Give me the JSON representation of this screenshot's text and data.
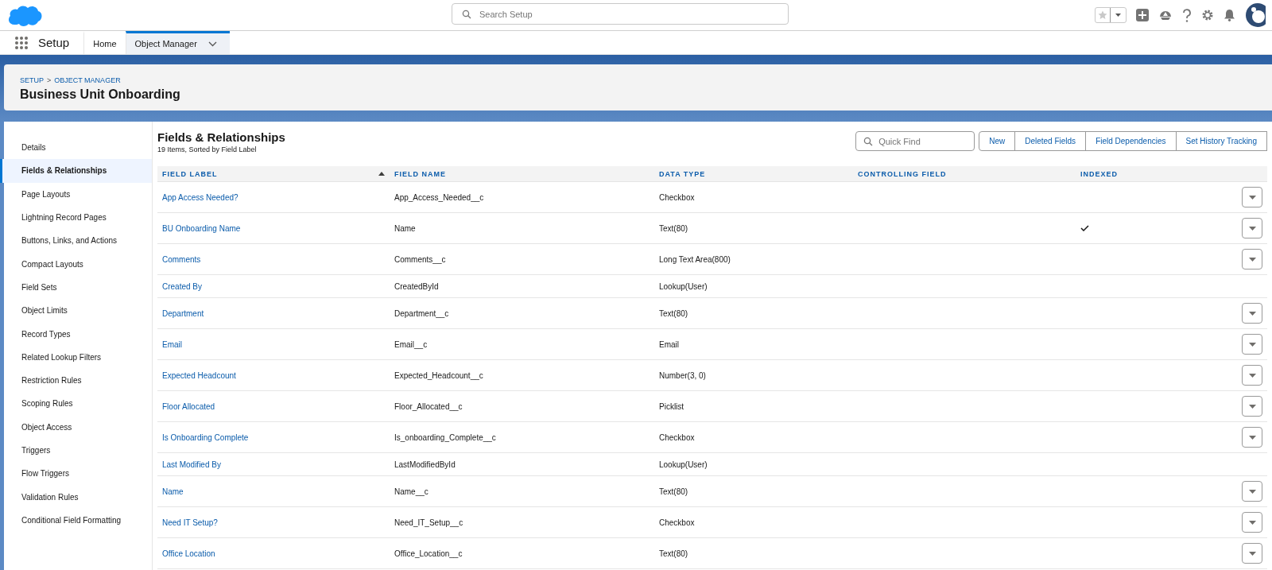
{
  "header": {
    "search": {
      "placeholder": "Search Setup"
    }
  },
  "nav": {
    "app_name": "Setup",
    "tabs": [
      {
        "label": "Home",
        "selected": false,
        "has_menu": false
      },
      {
        "label": "Object Manager",
        "selected": true,
        "has_menu": true
      }
    ]
  },
  "page_header": {
    "breadcrumbs": [
      "SETUP",
      "OBJECT MANAGER"
    ],
    "separator": ">",
    "title": "Business Unit Onboarding"
  },
  "sidebar": {
    "items": [
      {
        "label": "Details",
        "selected": false
      },
      {
        "label": "Fields & Relationships",
        "selected": true
      },
      {
        "label": "Page Layouts",
        "selected": false
      },
      {
        "label": "Lightning Record Pages",
        "selected": false
      },
      {
        "label": "Buttons, Links, and Actions",
        "selected": false
      },
      {
        "label": "Compact Layouts",
        "selected": false
      },
      {
        "label": "Field Sets",
        "selected": false
      },
      {
        "label": "Object Limits",
        "selected": false
      },
      {
        "label": "Record Types",
        "selected": false
      },
      {
        "label": "Related Lookup Filters",
        "selected": false
      },
      {
        "label": "Restriction Rules",
        "selected": false
      },
      {
        "label": "Scoping Rules",
        "selected": false
      },
      {
        "label": "Object Access",
        "selected": false
      },
      {
        "label": "Triggers",
        "selected": false
      },
      {
        "label": "Flow Triggers",
        "selected": false
      },
      {
        "label": "Validation Rules",
        "selected": false
      },
      {
        "label": "Conditional Field Formatting",
        "selected": false
      }
    ]
  },
  "section": {
    "title": "Fields & Relationships",
    "subtitle": "19 Items, Sorted by Field Label",
    "quick_find": {
      "placeholder": "Quick Find"
    },
    "buttons": [
      "New",
      "Deleted Fields",
      "Field Dependencies",
      "Set History Tracking"
    ]
  },
  "table": {
    "columns": [
      {
        "label": "FIELD LABEL",
        "sorted": true
      },
      {
        "label": "FIELD NAME",
        "sorted": false
      },
      {
        "label": "DATA TYPE",
        "sorted": false
      },
      {
        "label": "CONTROLLING FIELD",
        "sorted": false
      },
      {
        "label": "INDEXED",
        "sorted": false
      }
    ],
    "rows": [
      {
        "field_label": "App Access Needed?",
        "field_name": "App_Access_Needed__c",
        "data_type": "Checkbox",
        "indexed": false,
        "has_actions": true
      },
      {
        "field_label": "BU Onboarding Name",
        "field_name": "Name",
        "data_type": "Text(80)",
        "indexed": true,
        "has_actions": true
      },
      {
        "field_label": "Comments",
        "field_name": "Comments__c",
        "data_type": "Long Text Area(800)",
        "indexed": false,
        "has_actions": true
      },
      {
        "field_label": "Created By",
        "field_name": "CreatedById",
        "data_type": "Lookup(User)",
        "indexed": false,
        "has_actions": false
      },
      {
        "field_label": "Department",
        "field_name": "Department__c",
        "data_type": "Text(80)",
        "indexed": false,
        "has_actions": true
      },
      {
        "field_label": "Email",
        "field_name": "Email__c",
        "data_type": "Email",
        "indexed": false,
        "has_actions": true
      },
      {
        "field_label": "Expected Headcount",
        "field_name": "Expected_Headcount__c",
        "data_type": "Number(3, 0)",
        "indexed": false,
        "has_actions": true
      },
      {
        "field_label": "Floor Allocated",
        "field_name": "Floor_Allocated__c",
        "data_type": "Picklist",
        "indexed": false,
        "has_actions": true
      },
      {
        "field_label": "Is Onboarding Complete",
        "field_name": "Is_onboarding_Complete__c",
        "data_type": "Checkbox",
        "indexed": false,
        "has_actions": true
      },
      {
        "field_label": "Last Modified By",
        "field_name": "LastModifiedById",
        "data_type": "Lookup(User)",
        "indexed": false,
        "has_actions": false
      },
      {
        "field_label": "Name",
        "field_name": "Name__c",
        "data_type": "Text(80)",
        "indexed": false,
        "has_actions": true
      },
      {
        "field_label": "Need IT Setup?",
        "field_name": "Need_IT_Setup__c",
        "data_type": "Checkbox",
        "indexed": false,
        "has_actions": true
      },
      {
        "field_label": "Office Location",
        "field_name": "Office_Location__c",
        "data_type": "Text(80)",
        "indexed": false,
        "has_actions": true
      }
    ]
  }
}
